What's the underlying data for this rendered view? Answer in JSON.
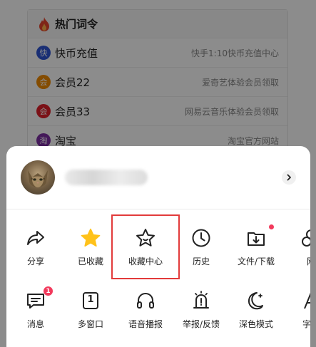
{
  "background": {
    "section_title": "热门词令",
    "rows": [
      {
        "badge": "快",
        "badge_color": "#2f55d4",
        "name": "快币充值",
        "desc": "快手1:10快币充值中心"
      },
      {
        "badge": "会",
        "badge_color": "#f08a00",
        "name": "会员22",
        "desc": "爱奇艺体验会员领取"
      },
      {
        "badge": "会",
        "badge_color": "#e0202a",
        "name": "会员33",
        "desc": "网易云音乐体验会员领取"
      },
      {
        "badge": "淘",
        "badge_color": "#7c2ea3",
        "name": "淘宝",
        "desc": "淘宝官方网站"
      }
    ]
  },
  "sheet": {
    "row1": [
      {
        "icon": "share-icon",
        "label": "分享"
      },
      {
        "icon": "star-filled-icon",
        "label": "已收藏"
      },
      {
        "icon": "star-outline-icon",
        "label": "收藏中心"
      },
      {
        "icon": "clock-history-icon",
        "label": "历史"
      },
      {
        "icon": "download-folder-icon",
        "label": "文件/下载"
      },
      {
        "icon": "web-icon",
        "label": "网"
      }
    ],
    "row2": [
      {
        "icon": "message-icon",
        "label": "消息",
        "badge": "1"
      },
      {
        "icon": "multi-window-icon",
        "label": "多窗口",
        "glyph": "1"
      },
      {
        "icon": "headphones-icon",
        "label": "语音播报"
      },
      {
        "icon": "report-alert-icon",
        "label": "举报/反馈"
      },
      {
        "icon": "moon-icon",
        "label": "深色模式"
      },
      {
        "icon": "font-icon",
        "label": "字体"
      }
    ]
  },
  "colors": {
    "accent_yellow": "#ffc21a",
    "badge_red": "#f23a5c",
    "highlight_red": "#e23b3b"
  }
}
